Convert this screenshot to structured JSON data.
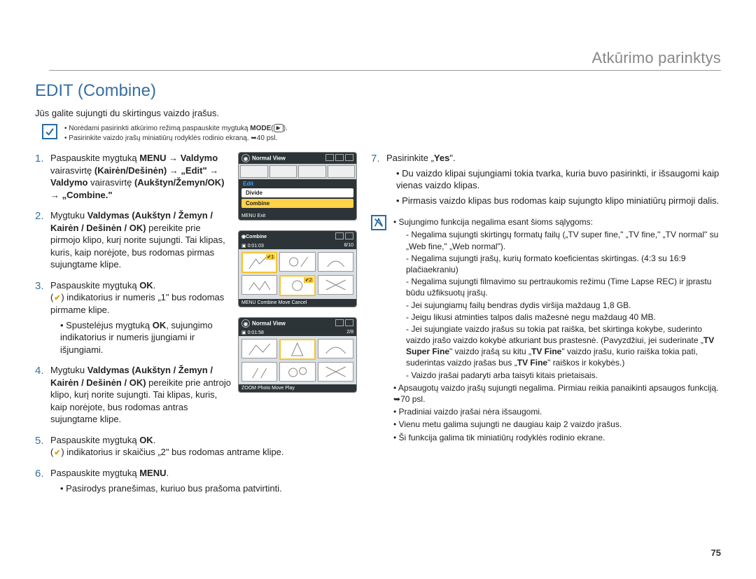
{
  "header": {
    "right": "Atkūrimo parinktys"
  },
  "title": "EDIT (Combine)",
  "intro": "Jūs galite sujungti du skirtingus vaizdo įrašus.",
  "noteTop": {
    "line1_a": "Norėdami pasirinkti atkūrimo režimą paspauskite mygtuką ",
    "line1_b": "MODE",
    "line1_c": "(",
    "line1_d": ").",
    "line2_a": "Pasirinkite vaizdo įrašų miniatiūrų rodyklės rodinio ekraną. ",
    "line2_b": "40 psl."
  },
  "leftSteps": {
    "s1_a": "Paspauskite mygtuką ",
    "s1_b": "MENU",
    "s1_c": " → ",
    "s1_d": "Valdymo",
    "s1_e": " vairasvirtę ",
    "s1_f": "(Kairėn/Dešinėn)",
    "s1_g": " → ",
    "s1_h": "„Edit\"",
    "s1_i": " → ",
    "s1_j": "Valdymo",
    "s1_k": " vairasvirtę ",
    "s1_l": "(Aukštyn/Žemyn/OK)",
    "s1_m": " → ",
    "s1_n": "„Combine.\"",
    "s2_a": "Mygtuku ",
    "s2_b": "Valdymas (Aukštyn / Žemyn / Kairėn / Dešinėn / OK)",
    "s2_c": " pereikite prie pirmojo klipo, kurį norite sujungti. Tai klipas, kuris, kaip norėjote, bus rodomas pirmas sujungtame klipe.",
    "s3_a": "Paspauskite mygtuką ",
    "s3_b": "OK",
    "s3_c": ".",
    "s3_line2_a": "(",
    "s3_line2_b": ") indikatorius ir numeris „1\" bus rodomas pirmame klipe.",
    "s3_sub_a": "Spustelėjus mygtuką ",
    "s3_sub_b": "OK",
    "s3_sub_c": ", sujungimo indikatorius ir numeris įjungiami ir išjungiami.",
    "s4_a": "Mygtuku ",
    "s4_b": "Valdymas (Aukštyn / Žemyn / Kairėn / Dešinėn / OK)",
    "s4_c": " pereikite prie antrojo klipo, kurį norite sujungti. Tai klipas, kuris, kaip norėjote, bus rodomas antras sujungtame klipe.",
    "s5_a": "Paspauskite mygtuką ",
    "s5_b": "OK",
    "s5_c": ".",
    "s5_line2_a": "(",
    "s5_line2_b": ") indikatorius ir skaičius „2\" bus rodomas antrame klipe.",
    "s6_a": "Paspauskite mygtuką ",
    "s6_b": "MENU",
    "s6_c": ".",
    "s6_sub": "Pasirodys pranešimas, kuriuo bus prašoma patvirtinti."
  },
  "rightCol": {
    "s7_a": "Pasirinkite „",
    "s7_b": "Yes",
    "s7_c": "\".",
    "s7_sub1": "Du vaizdo klipai sujungiami tokia tvarka, kuria buvo pasirinkti, ir išsaugomi kaip vienas vaizdo klipas.",
    "s7_sub2": "Pirmasis vaizdo klipas bus rodomas kaip sujungto klipo miniatiūrų pirmoji dalis.",
    "nb_lead": "Sujungimo funkcija negalima esant šioms sąlygoms:",
    "nb_d1": "Negalima sujungti skirtingų formatų failų („TV super fine,\" „TV fine,\" „TV normal\" su „Web fine,\" „Web normal\").",
    "nb_d2": "Negalima sujungti įrašų, kurių formato koeficientas skirtingas. (4:3 su 16:9 plačiaekraniu)",
    "nb_d3": "Negalima sujungti filmavimo su pertraukomis režimu (Time Lapse REC) ir įprastu būdu užfiksuotų įrašų.",
    "nb_d4": "Jei sujungiamų failų bendras dydis viršija maždaug 1,8 GB.",
    "nb_d5": "Jeigu likusi atminties talpos dalis mažesnė negu maždaug 40 MB.",
    "nb_d6_a": "Jei sujungiate vaizdo įrašus su tokia pat raiška, bet skirtinga kokybe, suderinto vaizdo įrašo vaizdo kokybė atkuriant bus prastesnė. (Pavyzdžiui, jei suderinate „",
    "nb_d6_b": "TV Super Fine",
    "nb_d6_c": "\" vaizdo įrašą su kitu „",
    "nb_d6_d": "TV Fine",
    "nb_d6_e": "\" vaizdo įrašu, kurio raiška tokia pati, suderintas vaizdo įrašas bus „",
    "nb_d6_f": "TV Fine",
    "nb_d6_g": "\" raiškos ir kokybės.)",
    "nb_d7": "Vaizdo įrašai padaryti arba taisyti kitais prietaisais.",
    "nb_b2_a": "Apsaugotų vaizdo įrašų sujungti negalima. Pirmiau reikia panaikinti apsaugos funkciją. ",
    "nb_b2_b": "70 psl.",
    "nb_b3": "Pradiniai vaizdo įrašai nėra išsaugomi.",
    "nb_b4": "Vienu metu galima sujungti ne daugiau kaip 2 vaizdo įrašus.",
    "nb_b5": "Ši funkcija galima tik miniatiūrų rodyklės rodinio ekrane."
  },
  "lcd": {
    "normalView": "Normal View",
    "edit": "Edit",
    "divide": "Divide",
    "combine": "Combine",
    "menuExit": "MENU Exit",
    "time": "0:01:03",
    "count": "8/10",
    "combineTitle": "Combine",
    "bottom2": "MENU Combine    Move    Cancel",
    "time3": "0:01:58",
    "count3": "2/8",
    "bottom3": "ZOOM Photo    Move    Play",
    "tag1": "1",
    "tag2": "2"
  },
  "pagenum": "75"
}
